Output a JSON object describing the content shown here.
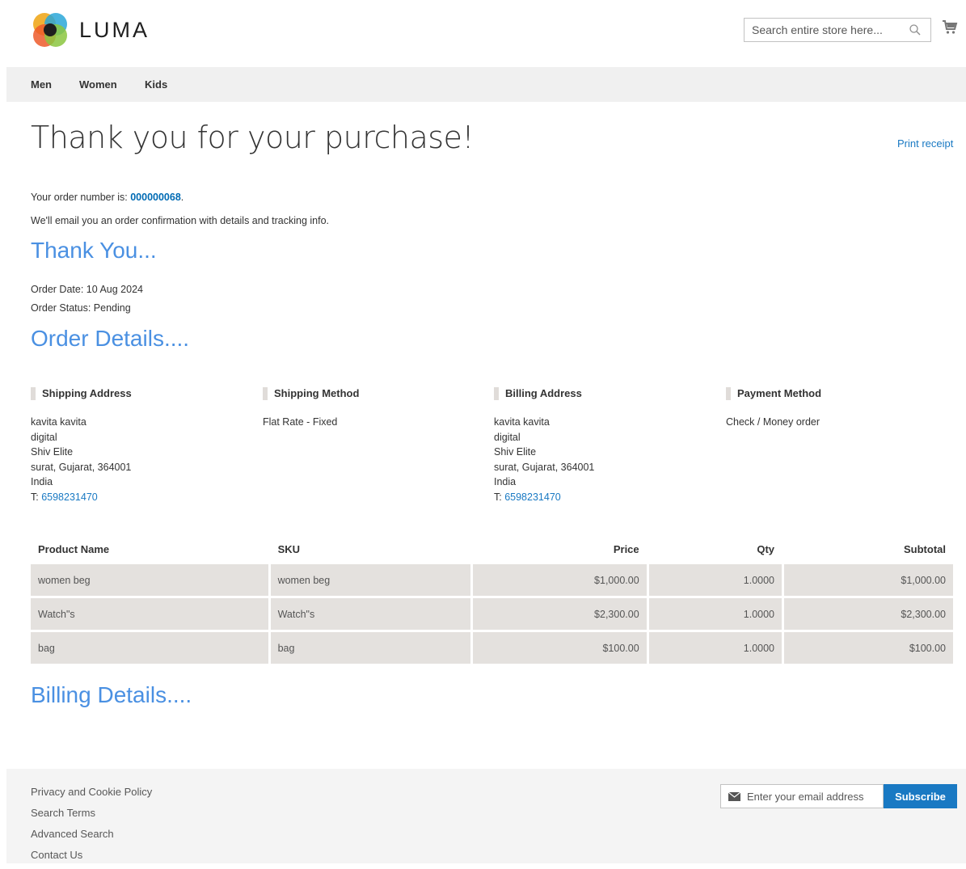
{
  "header": {
    "logo_text": "LUMA",
    "search_placeholder": "Search entire store here...",
    "icons": [
      "luma-logo-icon",
      "search-icon",
      "cart-icon"
    ]
  },
  "nav": {
    "items": [
      "Men",
      "Women",
      "Kids"
    ]
  },
  "page": {
    "title": "Thank you for your purchase!",
    "print_receipt": "Print receipt",
    "order_number_label": "Your order number is: ",
    "order_number": "000000068",
    "order_number_suffix": ".",
    "email_note": "We'll email you an order confirmation with details and tracking info.",
    "thank_you_heading": "Thank You...",
    "order_date": "Order Date: 10 Aug 2024",
    "order_status": "Order Status: Pending",
    "order_details_heading": "Order Details....",
    "billing_details_heading": "Billing Details...."
  },
  "addresses": {
    "shipping_address": {
      "title": "Shipping Address",
      "lines": [
        "kavita kavita",
        "digital",
        "Shiv Elite",
        "surat, Gujarat, 364001",
        "India"
      ],
      "phone_prefix": "T: ",
      "phone": "6598231470"
    },
    "shipping_method": {
      "title": "Shipping Method",
      "value": "Flat Rate - Fixed"
    },
    "billing_address": {
      "title": "Billing Address",
      "lines": [
        "kavita kavita",
        "digital",
        "Shiv Elite",
        "surat, Gujarat, 364001",
        "India"
      ],
      "phone_prefix": "T: ",
      "phone": "6598231470"
    },
    "payment_method": {
      "title": "Payment Method",
      "value": "Check / Money order"
    }
  },
  "items_table": {
    "headers": [
      "Product Name",
      "SKU",
      "Price",
      "Qty",
      "Subtotal"
    ],
    "rows": [
      [
        "women beg",
        "women beg",
        "$1,000.00",
        "1.0000",
        "$1,000.00"
      ],
      [
        "Watch\"s",
        "Watch\"s",
        "$2,300.00",
        "1.0000",
        "$2,300.00"
      ],
      [
        "bag",
        "bag",
        "$100.00",
        "1.0000",
        "$100.00"
      ]
    ]
  },
  "footer": {
    "links": [
      "Privacy and Cookie Policy",
      "Search Terms",
      "Advanced Search",
      "Contact Us"
    ],
    "newsletter_placeholder": "Enter your email address",
    "subscribe_label": "Subscribe"
  },
  "colors": {
    "link": "#1979c3",
    "heading_blue": "#4a90e2",
    "button": "#1979c3",
    "nav_bg": "#f0f0f0",
    "cell_bg": "#e4e1de"
  }
}
